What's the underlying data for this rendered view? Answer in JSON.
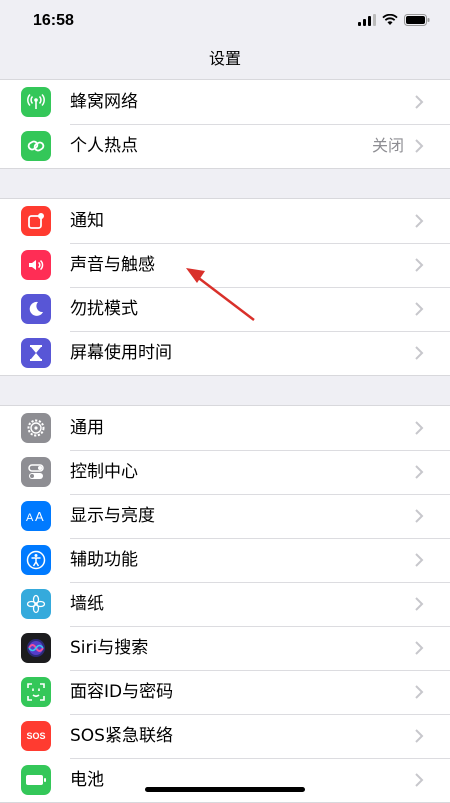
{
  "status_bar": {
    "time": "16:58"
  },
  "nav": {
    "title": "设置"
  },
  "groups": [
    {
      "items": [
        {
          "label": "蜂窝网络",
          "icon": "antenna-icon",
          "color": "#34c759"
        },
        {
          "label": "个人热点",
          "icon": "hotspot-chain-icon",
          "color": "#34c759",
          "value": "关闭"
        }
      ]
    },
    {
      "items": [
        {
          "label": "通知",
          "icon": "notification-icon",
          "color": "#ff3b30"
        },
        {
          "label": "声音与触感",
          "icon": "speaker-icon",
          "color": "#ff2d55"
        },
        {
          "label": "勿扰模式",
          "icon": "moon-icon",
          "color": "#5856d6"
        },
        {
          "label": "屏幕使用时间",
          "icon": "hourglass-icon",
          "color": "#5856d6"
        }
      ]
    },
    {
      "items": [
        {
          "label": "通用",
          "icon": "gear-icon",
          "color": "#8e8e93"
        },
        {
          "label": "控制中心",
          "icon": "toggles-icon",
          "color": "#8e8e93"
        },
        {
          "label": "显示与亮度",
          "icon": "text-size-icon",
          "color": "#007aff"
        },
        {
          "label": "辅助功能",
          "icon": "accessibility-icon",
          "color": "#007aff"
        },
        {
          "label": "墙纸",
          "icon": "flower-icon",
          "color": "#35aadc"
        },
        {
          "label": "Siri与搜索",
          "icon": "siri-icon",
          "color": "#1c1c1e"
        },
        {
          "label": "面容ID与密码",
          "icon": "face-id-icon",
          "color": "#34c759"
        },
        {
          "label": "SOS紧急联络",
          "icon": "sos-icon",
          "color": "#ff3b30",
          "icon_text": "SOS"
        },
        {
          "label": "电池",
          "icon": "battery-icon",
          "color": "#34c759"
        }
      ]
    }
  ],
  "annotation": {
    "type": "arrow",
    "color": "#d9302a",
    "points_to": "声音与触感"
  }
}
